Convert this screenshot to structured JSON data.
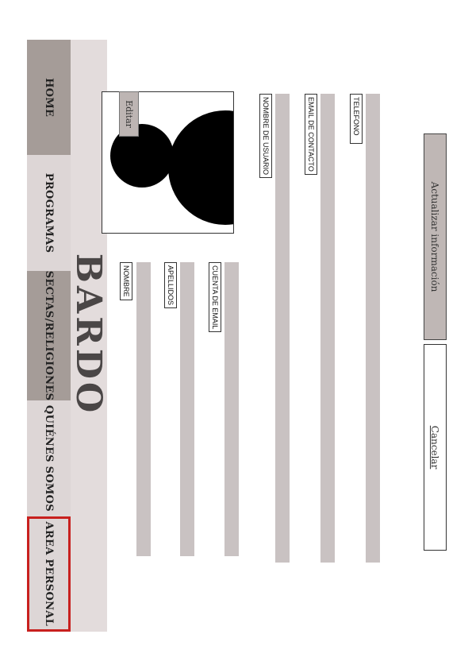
{
  "site": {
    "brand": "BARDO"
  },
  "nav": {
    "items": [
      {
        "label": "HOME"
      },
      {
        "label": "PROGRAMAS"
      },
      {
        "label": "SECTAS/RELIGIONES"
      },
      {
        "label": "QUIÉNES SOMOS"
      },
      {
        "label": "AREA PERSONAL"
      }
    ],
    "active_index": 4,
    "active_color": "#c8201e"
  },
  "profile": {
    "edit_label": "Editar",
    "avatar_icon": "person-silhouette-icon"
  },
  "form": {
    "nombre": "NOMBRE",
    "apellidos": "APELLIDOS",
    "cuenta_email": "CUENTA DE EMAIL",
    "nombre_usuario": "NOMBRE DE USUARIO",
    "email_contacto": "EMAIL DE CONTACTO",
    "telefono": "TELEFONO"
  },
  "actions": {
    "update_label": "Actualizar información",
    "cancel_label": "Cancelar"
  }
}
